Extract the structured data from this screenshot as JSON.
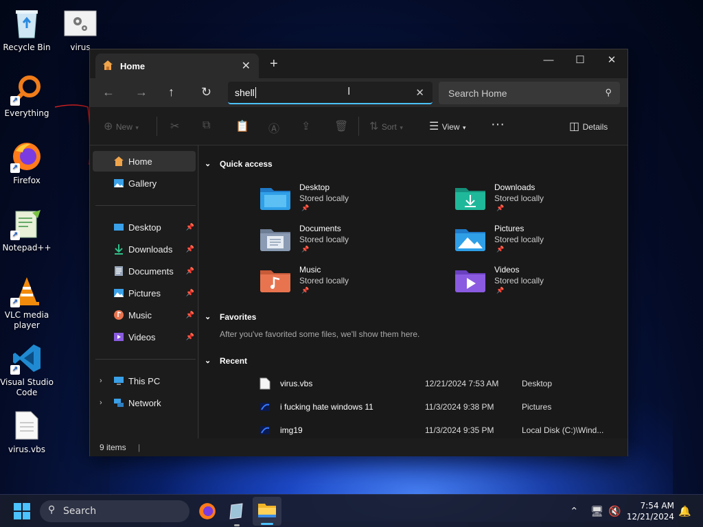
{
  "desktop": {
    "icons": [
      {
        "label": "Recycle Bin",
        "icon": "recycle-bin-icon"
      },
      {
        "label": "virus",
        "icon": "settings-file-icon"
      },
      {
        "label": "Everything",
        "icon": "everything-search-icon"
      },
      {
        "label": "Firefox",
        "icon": "firefox-icon"
      },
      {
        "label": "Notepad++",
        "icon": "notepad-plus-plus-icon"
      },
      {
        "label": "VLC media player",
        "icon": "vlc-cone-icon"
      },
      {
        "label": "Visual Studio Code",
        "icon": "vscode-icon"
      },
      {
        "label": "virus.vbs",
        "icon": "document-icon"
      }
    ]
  },
  "window": {
    "tab_title": "Home",
    "address_value": "shell",
    "search_placeholder": "Search Home",
    "toolbar": {
      "new_label": "New",
      "sort_label": "Sort",
      "view_label": "View",
      "details_label": "Details"
    },
    "sidebar": {
      "top": [
        {
          "label": "Home",
          "icon": "home-icon"
        },
        {
          "label": "Gallery",
          "icon": "gallery-icon"
        }
      ],
      "pinned": [
        {
          "label": "Desktop",
          "icon": "desktop-folder-icon"
        },
        {
          "label": "Downloads",
          "icon": "download-icon"
        },
        {
          "label": "Documents",
          "icon": "documents-icon"
        },
        {
          "label": "Pictures",
          "icon": "pictures-icon"
        },
        {
          "label": "Music",
          "icon": "music-icon"
        },
        {
          "label": "Videos",
          "icon": "videos-icon"
        }
      ],
      "bottom": [
        {
          "label": "This PC",
          "icon": "this-pc-icon"
        },
        {
          "label": "Network",
          "icon": "network-icon"
        }
      ]
    },
    "quick_access": {
      "heading": "Quick access",
      "items": [
        {
          "name": "Desktop",
          "sub": "Stored locally",
          "color": "#2f9fe8"
        },
        {
          "name": "Downloads",
          "sub": "Stored locally",
          "color": "#1fb89a"
        },
        {
          "name": "Documents",
          "sub": "Stored locally",
          "color": "#8a9bb3"
        },
        {
          "name": "Pictures",
          "sub": "Stored locally",
          "color": "#2f9fe8"
        },
        {
          "name": "Music",
          "sub": "Stored locally",
          "color": "#e8744f"
        },
        {
          "name": "Videos",
          "sub": "Stored locally",
          "color": "#8a5be0"
        }
      ]
    },
    "favorites": {
      "heading": "Favorites",
      "empty_text": "After you've favorited some files, we'll show them here."
    },
    "recent": {
      "heading": "Recent",
      "rows": [
        {
          "name": "virus.vbs",
          "date": "12/21/2024 7:53 AM",
          "location": "Desktop",
          "icon": "document-icon"
        },
        {
          "name": "i fucking hate windows 11",
          "date": "11/3/2024 9:38 PM",
          "location": "Pictures",
          "icon": "image-icon"
        },
        {
          "name": "img19",
          "date": "11/3/2024 9:35 PM",
          "location": "Local Disk (C:)\\Wind...",
          "icon": "image-icon"
        }
      ]
    },
    "status": "9 items"
  },
  "taskbar": {
    "search_label": "Search",
    "time": "7:54 AM",
    "date": "12/21/2024"
  }
}
